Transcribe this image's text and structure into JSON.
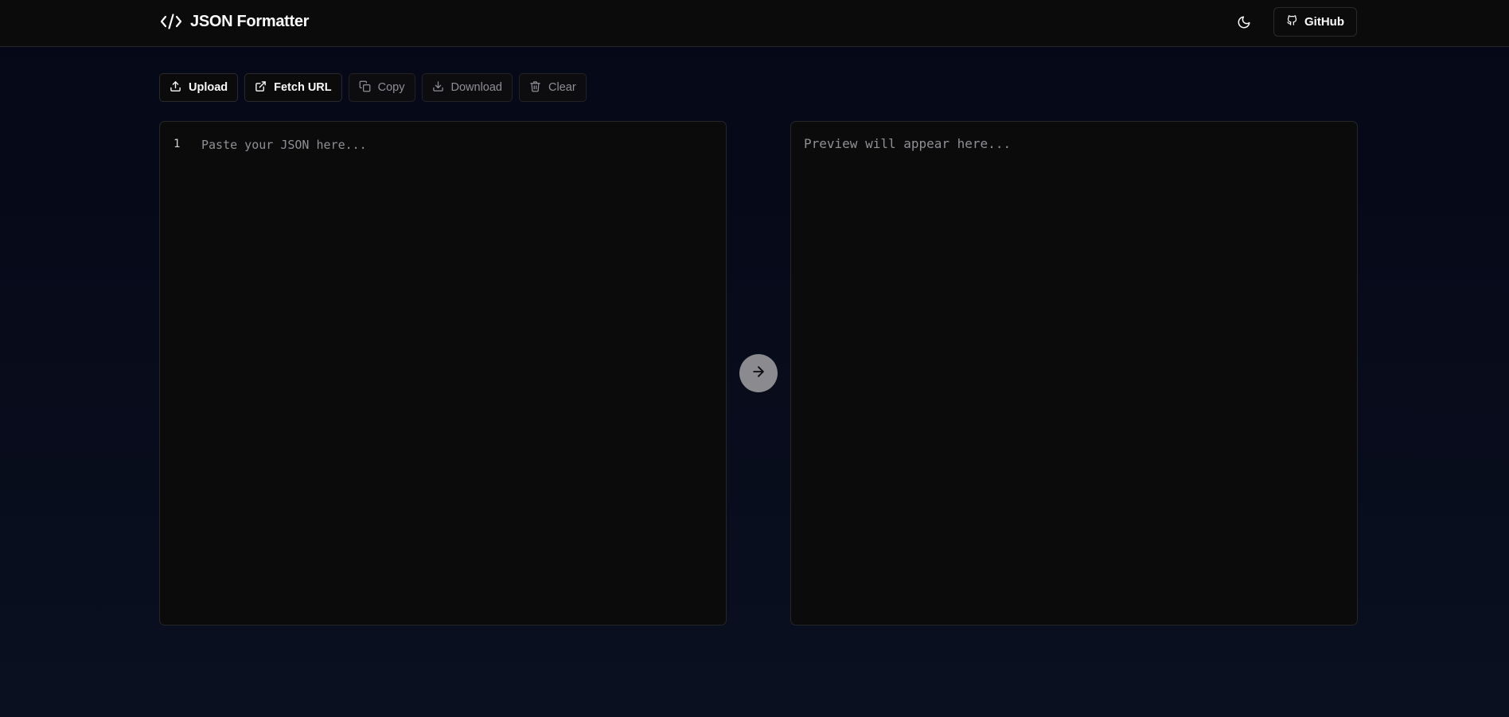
{
  "header": {
    "title": "JSON Formatter",
    "logo_icon": "code-brackets-icon",
    "theme_toggle_icon": "moon-icon",
    "github_label": "GitHub",
    "github_icon": "github-icon"
  },
  "toolbar": {
    "upload_label": "Upload",
    "fetch_url_label": "Fetch URL",
    "copy_label": "Copy",
    "download_label": "Download",
    "clear_label": "Clear"
  },
  "editor": {
    "line_numbers": [
      "1"
    ],
    "value": "",
    "placeholder": "Paste your JSON here..."
  },
  "preview": {
    "placeholder": "Preview will appear here..."
  },
  "convert_icon": "arrow-right-icon",
  "colors": {
    "background": "#050816",
    "panel": "#0b0b0c",
    "border": "#26262a",
    "text": "#fafafa",
    "muted_text": "#8f8f96",
    "convert_button": "#8b8b8f"
  }
}
